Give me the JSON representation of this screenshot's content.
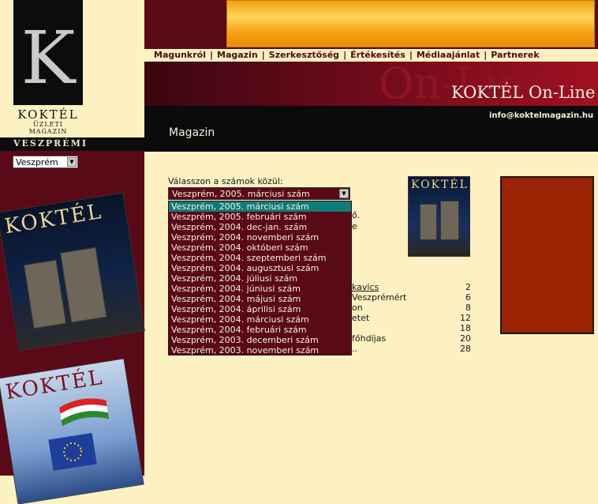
{
  "logo": {
    "letter": "K",
    "word": "KOKTÉL",
    "subtitle": "ÜZLETI MAGAZIN"
  },
  "city": {
    "label": "VESZPRÉMI",
    "select_value": "Veszprém"
  },
  "nav": {
    "items": [
      "Magunkról",
      "Magazin",
      "Szerkesztőség",
      "Értékesítés",
      "Médiaajánlat",
      "Partnerek"
    ]
  },
  "header": {
    "ghost_text": "On-Line",
    "title": "KOKTÉL On-Line",
    "email": "info@koktelmagazin.hu",
    "section_title": "Magazin"
  },
  "issue_picker": {
    "label": "Válasszon a számok közül:",
    "selected": "Veszprém, 2005. márciusi szám",
    "options": [
      "Veszprém, 2005. márciusi szám",
      "Veszprém, 2005. februári szám",
      "Veszprém, 2004. dec-jan. szám",
      "Veszprém, 2004. novemberi szám",
      "Veszprém, 2004. októberi szám",
      "Veszprém, 2004. szeptemberi szám",
      "Veszprém, 2004. augusztusi szám",
      "Veszprém, 2004. júliusi szám",
      "Veszprém, 2004. júniusi szám",
      "Veszprém, 2004. májusi szám",
      "Veszprém, 2004. áprilisi szám",
      "Veszprém, 2004. márciusi szám",
      "Veszprém, 2004. februári szám",
      "Veszprém, 2003. decemberi szám",
      "Veszprém, 2003. novemberi szám"
    ]
  },
  "contents_fragments": {
    "top": [
      "ő.",
      "e"
    ],
    "rows": [
      {
        "text": "kavics",
        "page": "2"
      },
      {
        "text": "Veszprémért",
        "page": "6"
      },
      {
        "text": "on",
        "page": "8"
      },
      {
        "text": "etet",
        "page": "12"
      },
      {
        "text": "",
        "page": "18"
      },
      {
        "text": "főhdíjas",
        "page": "20"
      },
      {
        "text": "..",
        "page": "28"
      }
    ]
  },
  "covers": {
    "title": "KOKTÉL"
  },
  "colors": {
    "maroon": "#5a0916",
    "cream": "#fdf1c2",
    "highlight": "#107b7b",
    "side_box": "#9b2203"
  }
}
